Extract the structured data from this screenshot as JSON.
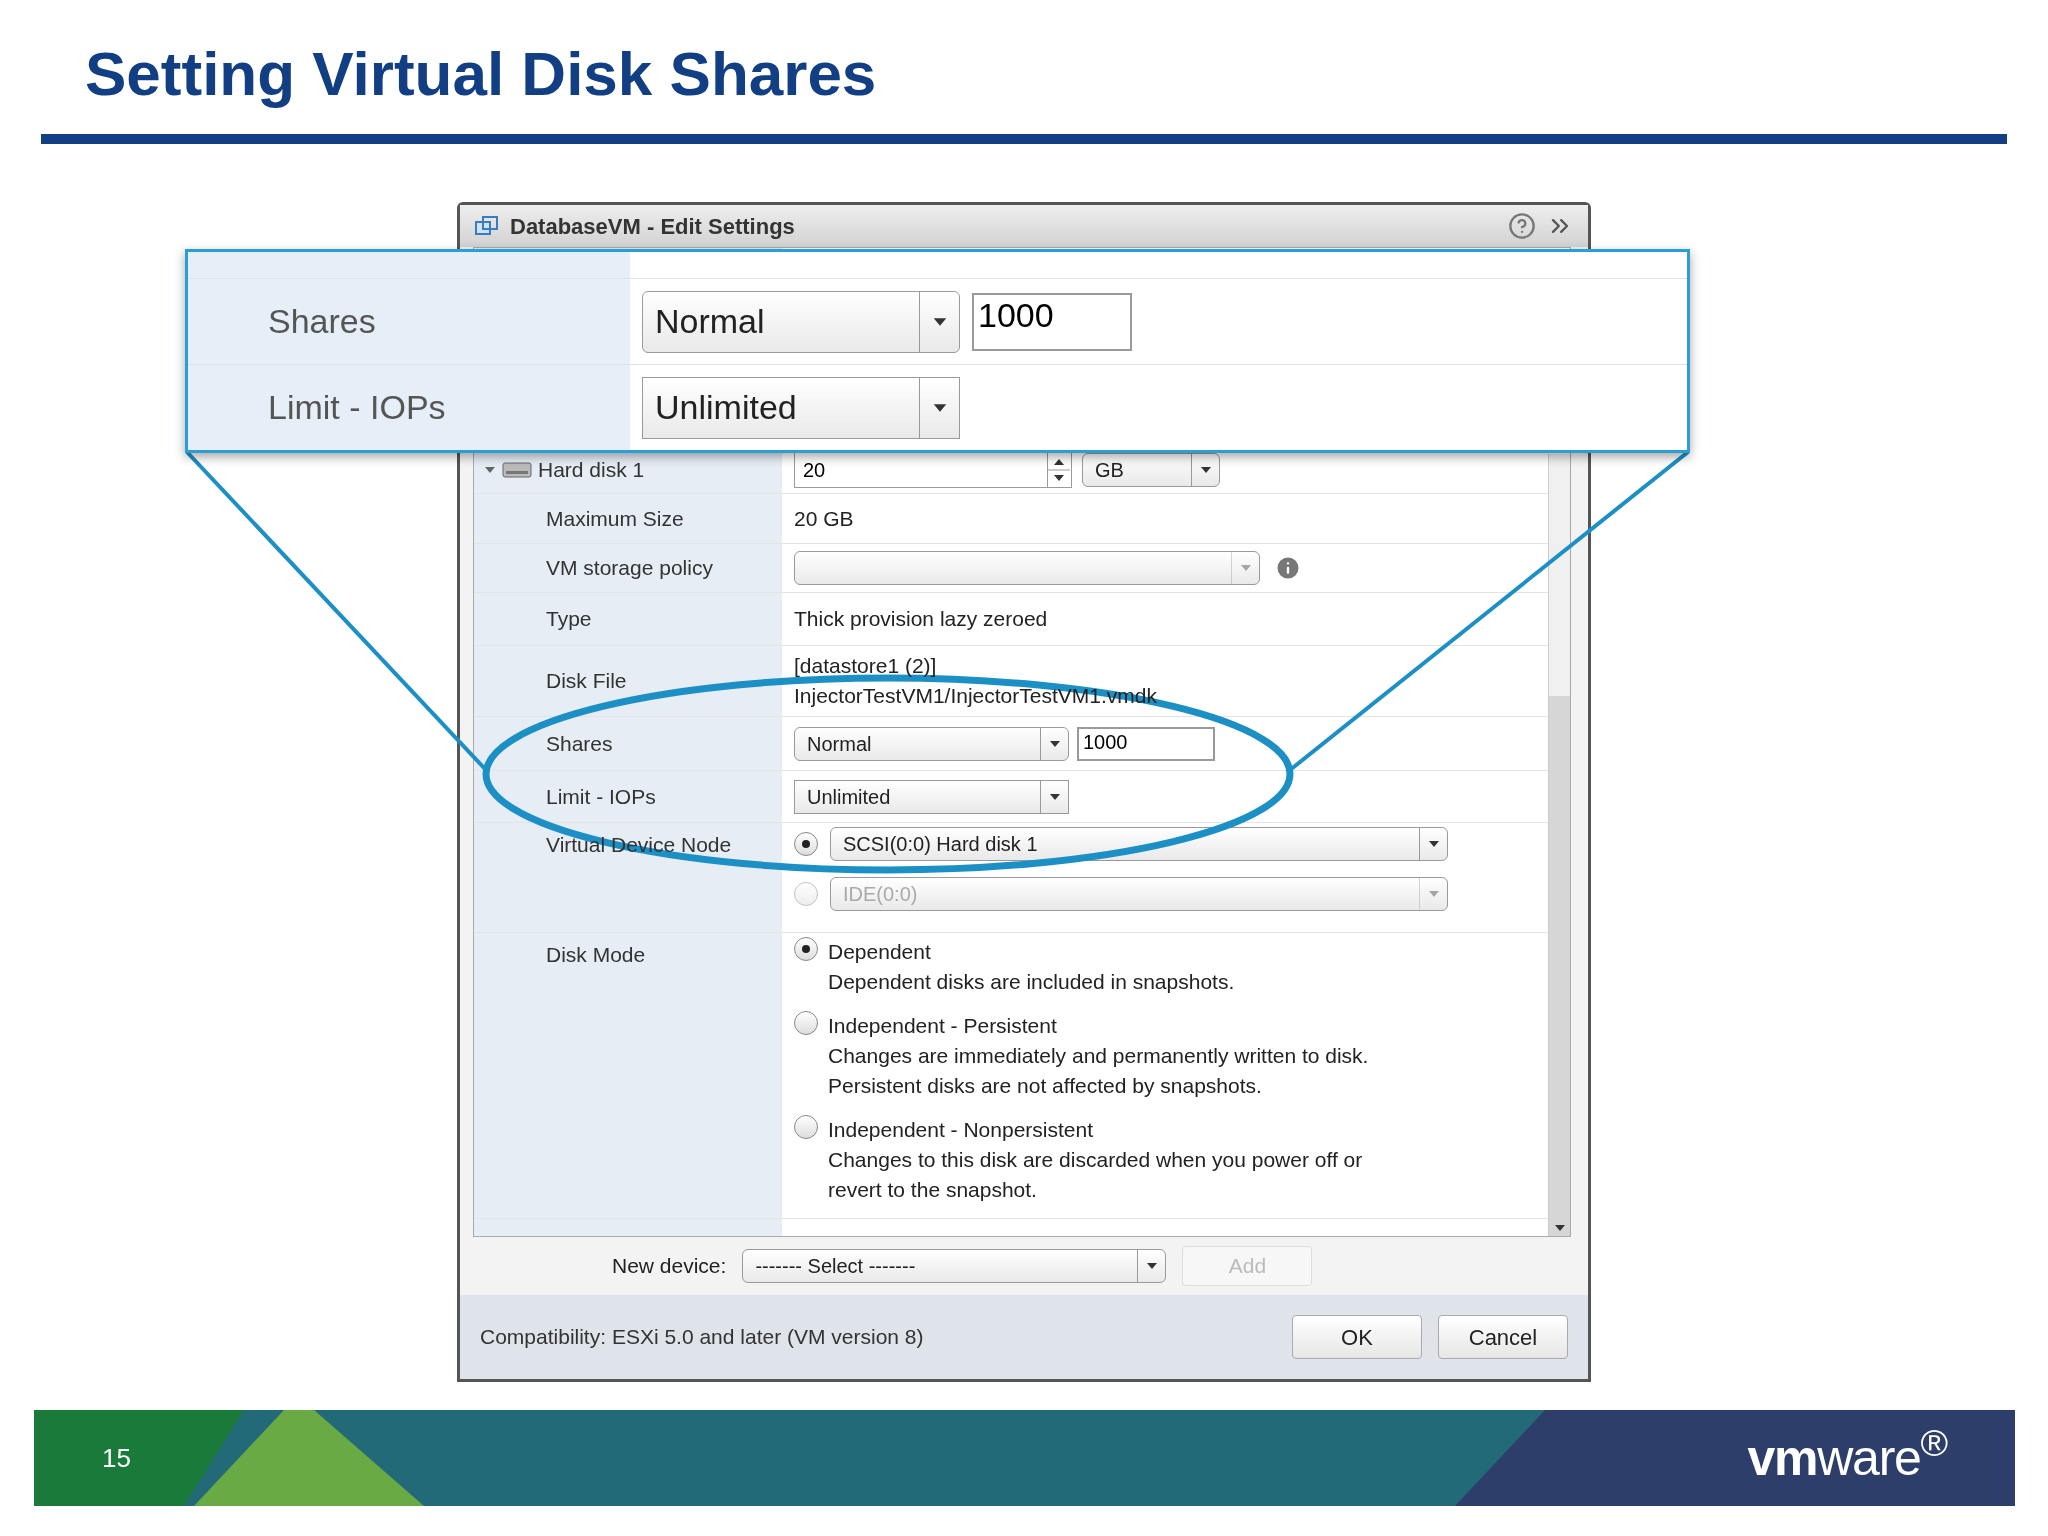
{
  "slide": {
    "title": "Setting Virtual Disk Shares",
    "page_number": "15",
    "logo": "**vm**ware$^{®}$"
  },
  "dialog": {
    "title": "DatabaseVM - Edit Settings",
    "rows": [
      {
        "kind": "disk",
        "label": "Hard disk 1",
        "expanded": true,
        "value": "20",
        "unit": "GB"
      },
      {
        "kind": "text",
        "label": "Maximum Size",
        "lines": [
          "20 GB"
        ]
      },
      {
        "kind": "policy",
        "label": "VM storage policy"
      },
      {
        "kind": "text",
        "label": "Type",
        "lines": [
          "Thick provision lazy zeroed"
        ]
      },
      {
        "kind": "text",
        "label": "Disk File",
        "lines": [
          "[datastore1 (2)]",
          "InjectorTestVM1/InjectorTestVM1.vmdk"
        ]
      },
      {
        "kind": "shares",
        "label": "Shares",
        "select": "Normal",
        "value": "1000"
      },
      {
        "kind": "select",
        "label": "Limit - IOPs",
        "select": "Unlimited"
      },
      {
        "kind": "node",
        "label": "Virtual Device Node",
        "options": [
          {
            "label": "SCSI(0:0) Hard disk 1",
            "selected": true,
            "disabled": false
          },
          {
            "label": "IDE(0:0)",
            "selected": false,
            "disabled": true
          }
        ]
      },
      {
        "kind": "radio",
        "label": "Disk Mode",
        "options": [
          {
            "title": "Dependent",
            "lines": [
              "Dependent disks are included in snapshots."
            ],
            "selected": true
          },
          {
            "title": "Independent - Persistent",
            "lines": [
              "Changes are immediately and permanently written to disk.",
              "Persistent disks are not affected by snapshots."
            ],
            "selected": false
          },
          {
            "title": "Independent - Nonpersistent",
            "lines": [
              "Changes to this disk are discarded when you power off or",
              "revert to the snapshot."
            ],
            "selected": false
          }
        ]
      }
    ],
    "new_device": {
      "label": "New device:",
      "select": "------- Select -------",
      "add_button": {
        "label": "Add",
        "disabled": true
      }
    },
    "compatibility": "Compatibility: ESXi 5.0 and later (VM version 8)",
    "buttons": [
      "OK",
      "Cancel"
    ]
  },
  "callout": {
    "rows": [
      {
        "kind": "shares",
        "label": "Shares",
        "select": "Normal",
        "value": "1000"
      },
      {
        "kind": "select",
        "label": "Limit - IOPs",
        "select": "Unlimited"
      }
    ]
  }
}
